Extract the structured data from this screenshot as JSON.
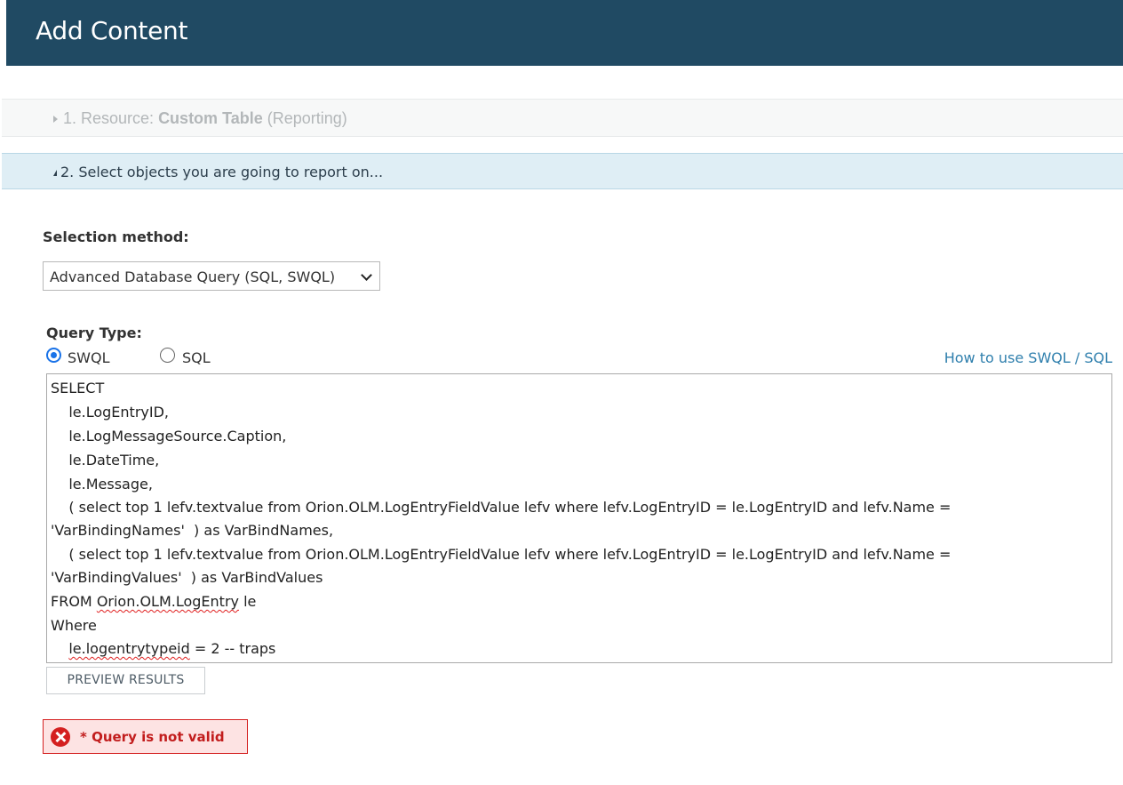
{
  "header": {
    "title": "Add Content",
    "background_color": "#204a63"
  },
  "steps": [
    {
      "prefix": "1. Resource: ",
      "resource_name": "Custom Table",
      "suffix": "(Reporting)",
      "expanded": false
    },
    {
      "label": "2. Select objects you are going to report on...",
      "expanded": true
    }
  ],
  "selection": {
    "label": "Selection method:",
    "value": "Advanced Database Query (SQL, SWQL)"
  },
  "query_type": {
    "label": "Query Type:",
    "options": [
      {
        "label": "SWQL",
        "selected": true
      },
      {
        "label": "SQL",
        "selected": false
      }
    ],
    "help_link": "How to use SWQL / SQL"
  },
  "query": {
    "lines": [
      "SELECT",
      "    le.LogEntryID,",
      "    le.LogMessageSource.Caption,",
      "    le.DateTime,",
      "    le.Message,",
      "    ( select top 1 lefv.textvalue from Orion.OLM.LogEntryFieldValue lefv where lefv.LogEntryID = le.LogEntryID and lefv.Name =",
      "'VarBindingNames'  ) as VarBindNames,",
      "    ( select top 1 lefv.textvalue from Orion.OLM.LogEntryFieldValue lefv where lefv.LogEntryID = le.LogEntryID and lefv.Name =",
      "'VarBindingValues'  ) as VarBindValues",
      "FROM ",
      "Orion.OLM.LogEntry",
      " le",
      "Where",
      "    ",
      "le.logentrytypeid",
      " = 2 -- traps"
    ]
  },
  "preview_button": "PREVIEW RESULTS",
  "error": {
    "message": "* Query is not valid",
    "icon": "error-x-icon",
    "color": "#d42020"
  },
  "colors": {
    "link": "#2f7fad",
    "step2_bg": "#dfeef5",
    "radio_selected": "#1a73e8"
  }
}
